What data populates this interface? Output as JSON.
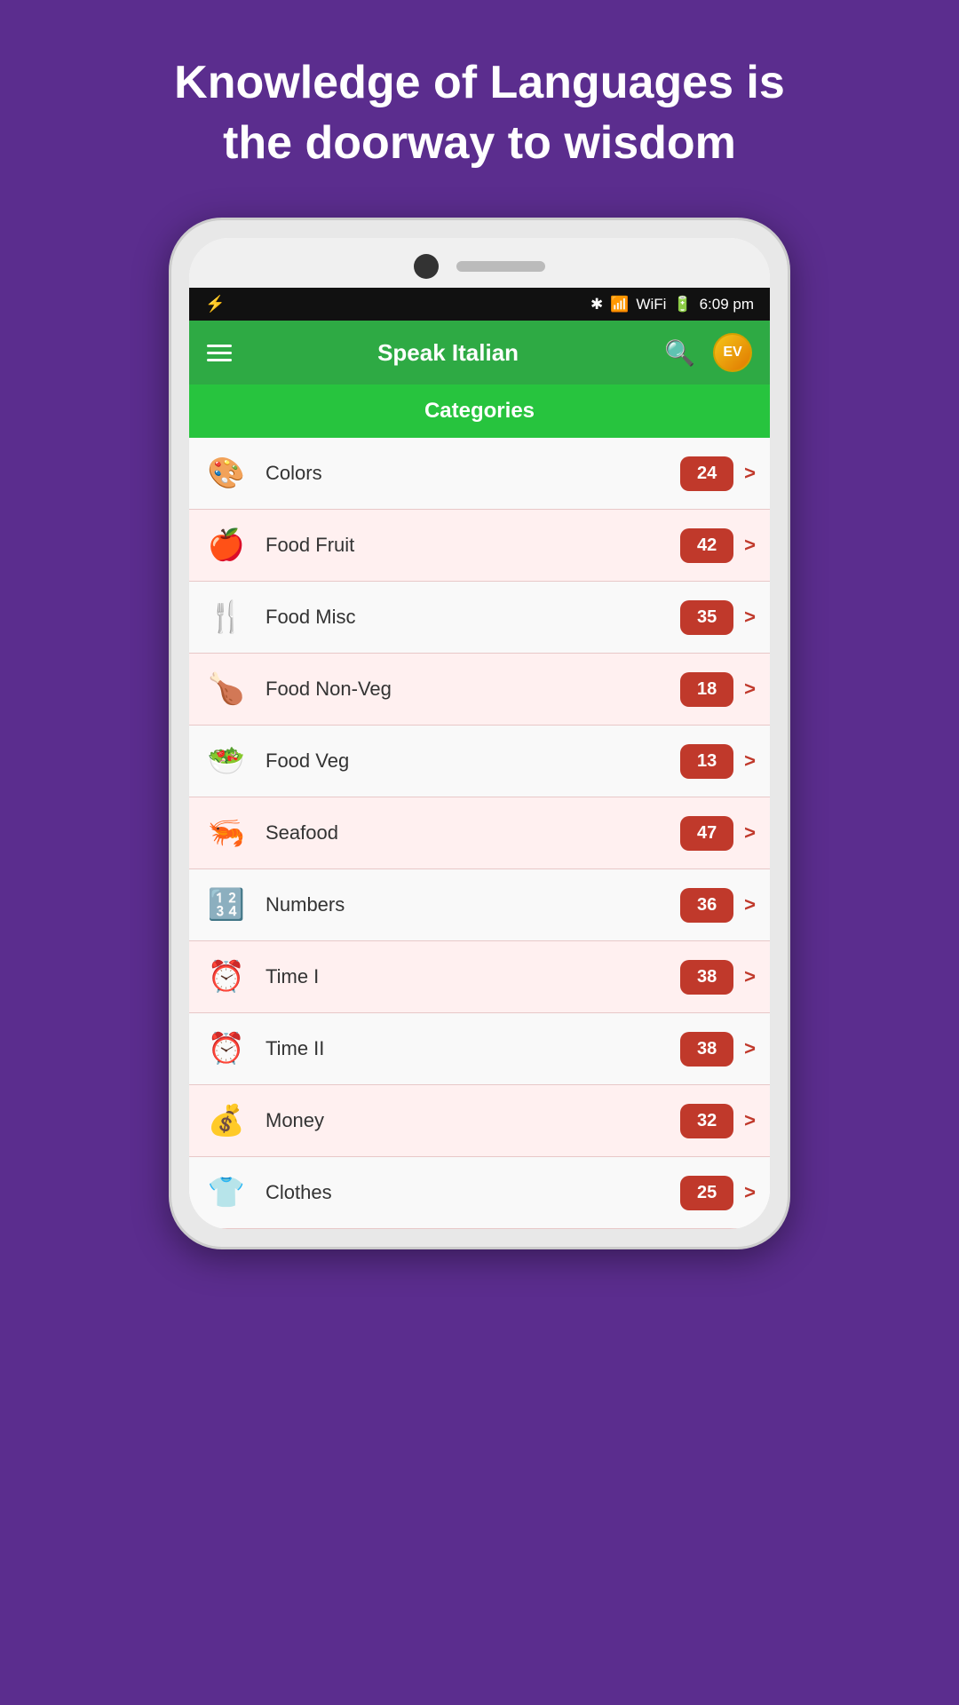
{
  "quote": {
    "line1": "Knowledge of Languages is",
    "line2": "the doorway to wisdom"
  },
  "status_bar": {
    "left_icon": "⚡",
    "time": "6:09 pm",
    "battery": "▮▮▮"
  },
  "toolbar": {
    "title": "Speak Italian",
    "ev_label": "EV"
  },
  "categories_label": "Categories",
  "categories": [
    {
      "name": "Colors",
      "count": "24",
      "icon": "🎨"
    },
    {
      "name": "Food Fruit",
      "count": "42",
      "icon": "🍎"
    },
    {
      "name": "Food Misc",
      "count": "35",
      "icon": "🍴"
    },
    {
      "name": "Food Non-Veg",
      "count": "18",
      "icon": "🍗"
    },
    {
      "name": "Food Veg",
      "count": "13",
      "icon": "🥗"
    },
    {
      "name": "Seafood",
      "count": "47",
      "icon": "🦐"
    },
    {
      "name": "Numbers",
      "count": "36",
      "icon": "🔢"
    },
    {
      "name": "Time I",
      "count": "38",
      "icon": "⏰"
    },
    {
      "name": "Time II",
      "count": "38",
      "icon": "⏰"
    },
    {
      "name": "Money",
      "count": "32",
      "icon": "💰"
    },
    {
      "name": "Clothes",
      "count": "25",
      "icon": "👕"
    }
  ]
}
